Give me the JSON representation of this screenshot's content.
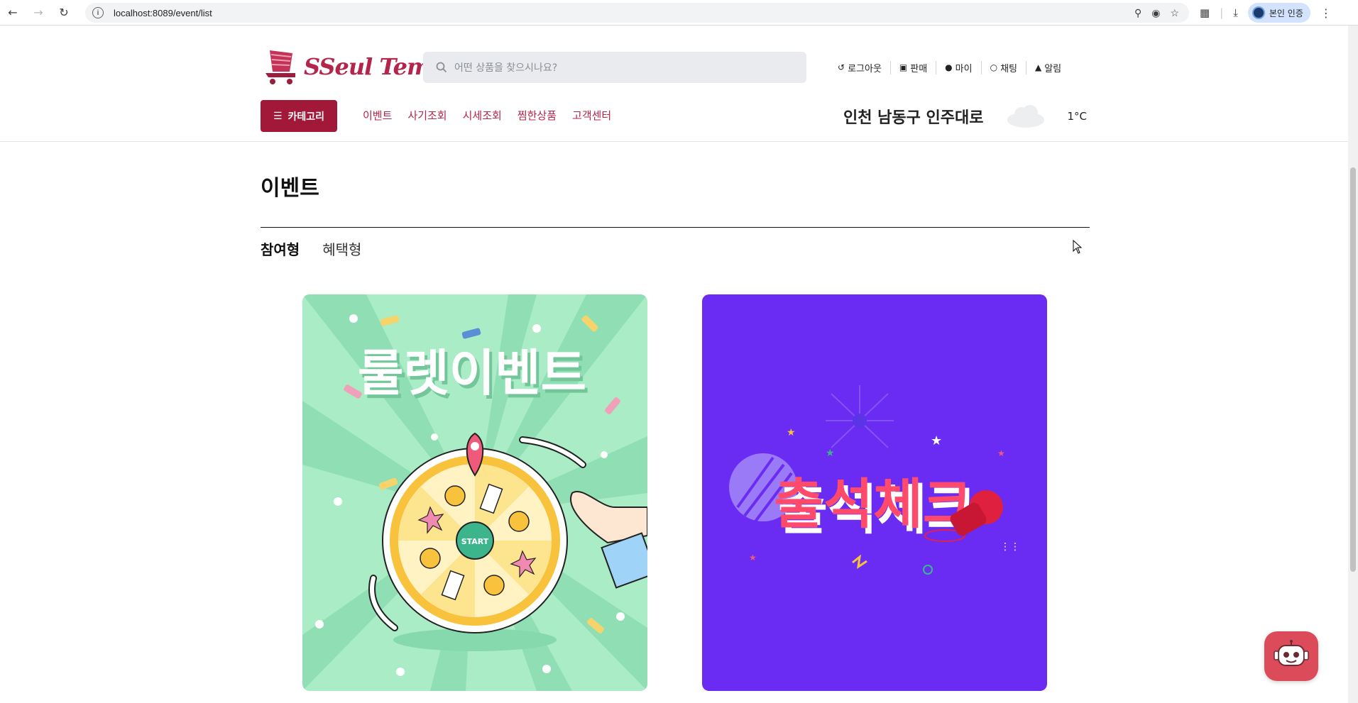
{
  "browser": {
    "url": "localhost:8089/event/list",
    "profile_label": "본인 인증"
  },
  "header": {
    "logo_text": "SSeul Tem",
    "search_placeholder": "어떤 상품을 찾으시나요?",
    "util_links": [
      {
        "label": "로그아웃",
        "icon": "logout-icon"
      },
      {
        "label": "판매",
        "icon": "shopping-bag-icon"
      },
      {
        "label": "마이",
        "icon": "user-icon"
      },
      {
        "label": "채팅",
        "icon": "chat-icon"
      },
      {
        "label": "알림",
        "icon": "bell-icon"
      }
    ],
    "category_button": "카테고리",
    "menu": [
      "이벤트",
      "사기조회",
      "시세조회",
      "찜한상품",
      "고객센터"
    ],
    "weather": {
      "location": "인천 남동구 인주대로",
      "icon": "cloud-icon",
      "temperature": "1°C"
    }
  },
  "page": {
    "title": "이벤트",
    "tabs": [
      {
        "label": "참여형",
        "active": true
      },
      {
        "label": "혜택형",
        "active": false
      }
    ],
    "events": [
      {
        "banner_text": "룰렛이벤트",
        "center_label": "START",
        "background": "#a9ecc5"
      },
      {
        "banner_text": "출석체크",
        "background": "#6a2cf2"
      }
    ]
  },
  "colors": {
    "brand": "#a11839",
    "brand_text": "#b5244a",
    "chatbot": "#dc4b5a"
  }
}
